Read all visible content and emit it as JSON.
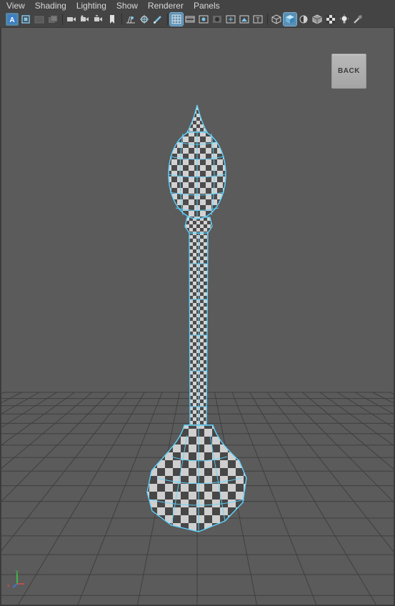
{
  "menu": {
    "items": [
      "View",
      "Shading",
      "Lighting",
      "Show",
      "Renderer",
      "Panels"
    ]
  },
  "toolbar": {
    "groups": [
      [
        "select-camera-icon",
        "camera-attributes-icon",
        "bookmarks-icon",
        "image-plane-icon"
      ],
      [
        "camera-icon",
        "film-gate-icon",
        "resolution-gate-icon",
        "gate-mask-icon",
        "bookmark-icon",
        "grid-icon",
        "magnet-icon"
      ],
      [
        "wireframe-icon",
        "smooth-shade-icon",
        "default-material-icon",
        "shaded-wireframe-icon",
        "textured-icon",
        "use-all-lights-icon",
        "shadows-icon",
        "xray-icon"
      ],
      [
        "wireframe-cube-icon",
        "shaded-cube-icon",
        "half-sphere-icon",
        "isolate-icon",
        "checker-icon",
        "light-bulb-icon",
        "more-icon"
      ]
    ]
  },
  "viewport": {
    "back_label": "BACK",
    "axis": {
      "x_label": "x",
      "y_label": "y",
      "z_label": "z"
    },
    "colors": {
      "background": "#5b5b5b",
      "grid": "#3f3f3f",
      "wire": "#60d4ff",
      "checker_light": "#d2d2d2",
      "checker_dark": "#4c4c4c"
    }
  }
}
